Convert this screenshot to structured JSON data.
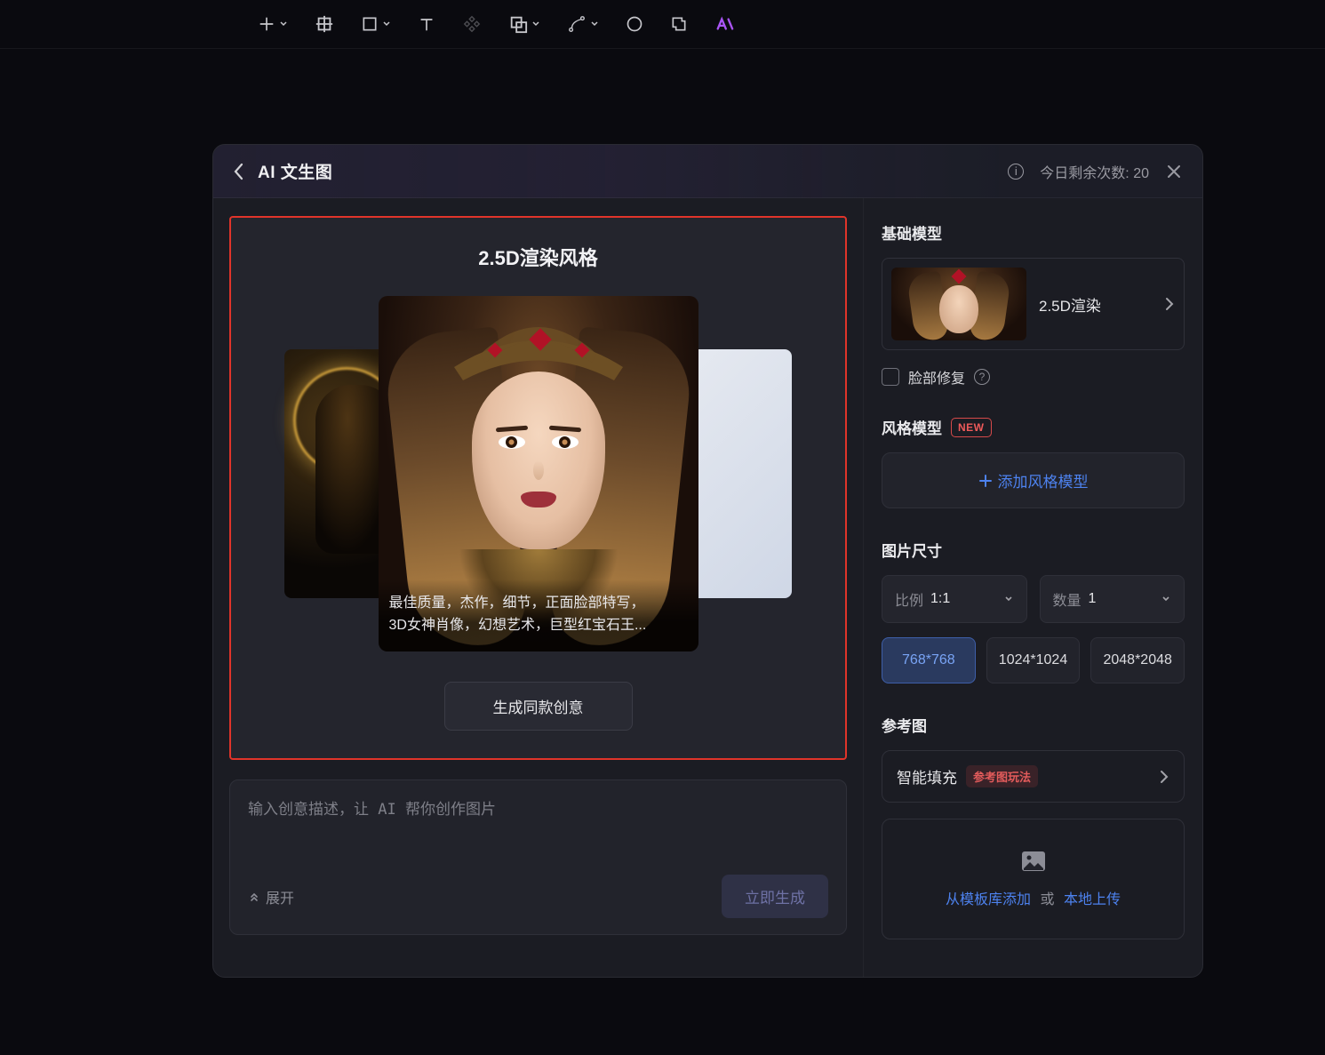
{
  "toolbar": {
    "tools": [
      "add",
      "crop",
      "rect",
      "text",
      "align",
      "merge",
      "path",
      "circle",
      "slice",
      "ai"
    ]
  },
  "panel": {
    "title": "AI 文生图",
    "quota_text": "今日剩余次数: 20"
  },
  "preview": {
    "style_title": "2.5D渲染风格",
    "caption_line1": "最佳质量，杰作，细节，正面脸部特写，",
    "caption_line2": "3D女神肖像，幻想艺术，巨型红宝石王...",
    "generate_same": "生成同款创意"
  },
  "prompt": {
    "placeholder": "输入创意描述，让 AI 帮你创作图片",
    "expand": "展开",
    "generate": "立即生成"
  },
  "sections": {
    "base_model": "基础模型",
    "style_model": "风格模型",
    "new_badge": "NEW",
    "image_size": "图片尺寸",
    "reference_image": "参考图"
  },
  "base_model": {
    "name": "2.5D渲染"
  },
  "face_fix": {
    "label": "脸部修复"
  },
  "add_style_label": "添加风格模型",
  "ratio": {
    "label": "比例",
    "value": "1:1"
  },
  "count": {
    "label": "数量",
    "value": "1"
  },
  "sizes": {
    "a": "768*768",
    "b": "1024*1024",
    "c": "2048*2048"
  },
  "reference": {
    "smart_fill": "智能填充",
    "badge": "参考图玩法",
    "from_template": "从模板库添加",
    "or": "或",
    "local_upload": "本地上传"
  }
}
